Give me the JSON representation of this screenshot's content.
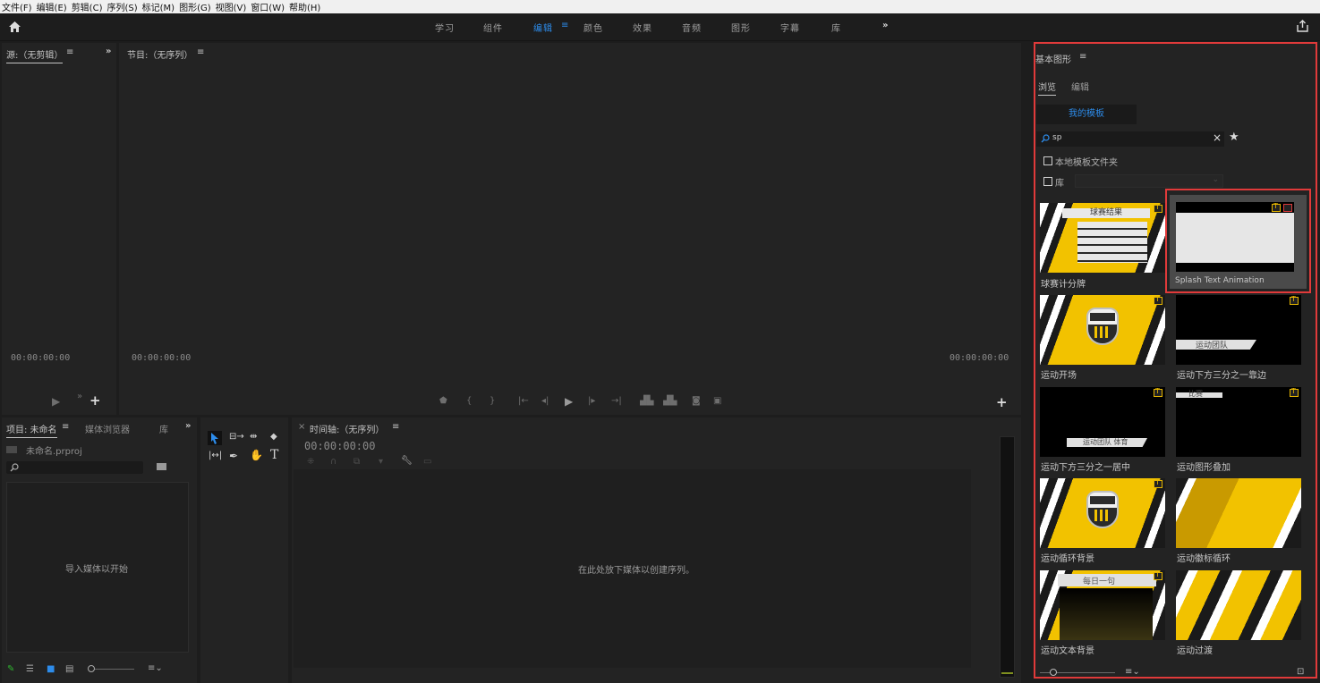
{
  "menu": [
    "文件(F)",
    "编辑(E)",
    "剪辑(C)",
    "序列(S)",
    "标记(M)",
    "图形(G)",
    "视图(V)",
    "窗口(W)",
    "帮助(H)"
  ],
  "workspaces": [
    "学习",
    "组件",
    "编辑",
    "颜色",
    "效果",
    "音频",
    "图形",
    "字幕",
    "库"
  ],
  "active_workspace": "编辑",
  "source": {
    "title": "源:（无剪辑）",
    "timecode": "00:00:00:00"
  },
  "program": {
    "title": "节目:（无序列）",
    "timecode_left": "00:00:00:00",
    "timecode_right": "00:00:00:00"
  },
  "project": {
    "tabs": [
      "项目: 未命名",
      "媒体浏览器",
      "库"
    ],
    "file": "未命名.prproj",
    "empty_text": "导入媒体以开始"
  },
  "timeline": {
    "title": "时间轴:（无序列）",
    "timecode": "00:00:00:00",
    "empty_text": "在此处放下媒体以创建序列。"
  },
  "essential_graphics": {
    "title": "基本图形",
    "tabs": [
      "浏览",
      "编辑"
    ],
    "active_tab": "浏览",
    "templates_button": "我的模板",
    "search_value": "sp",
    "checkbox_local": "本地模板文件夹",
    "checkbox_library": "库",
    "templates": [
      {
        "label": "球赛计分牌",
        "thumb_text": "球赛结果"
      },
      {
        "label": "Splash Text Animation",
        "thumb_text": ""
      },
      {
        "label": "运动开场",
        "thumb_text": "ADOBE 运动"
      },
      {
        "label": "运动下方三分之一靠边",
        "thumb_text": "运动团队"
      },
      {
        "label": "运动下方三分之一居中",
        "thumb_text": "运动团队 体育"
      },
      {
        "label": "运动图形叠加",
        "thumb_text": "比赛"
      },
      {
        "label": "运动循环背景",
        "thumb_text": "ADOBE 运动"
      },
      {
        "label": "运动徽标循环",
        "thumb_text": ""
      },
      {
        "label": "运动文本背景",
        "thumb_text": "每日一句"
      },
      {
        "label": "运动过渡",
        "thumb_text": ""
      }
    ]
  },
  "colors": {
    "accent": "#2d8ceb",
    "highlight_red": "#e03a3a",
    "gold": "#f2c200"
  },
  "icons": [
    "home-icon",
    "share-icon",
    "search-icon",
    "clear-icon",
    "star-icon",
    "hamburger-icon",
    "chevrons-icon"
  ]
}
